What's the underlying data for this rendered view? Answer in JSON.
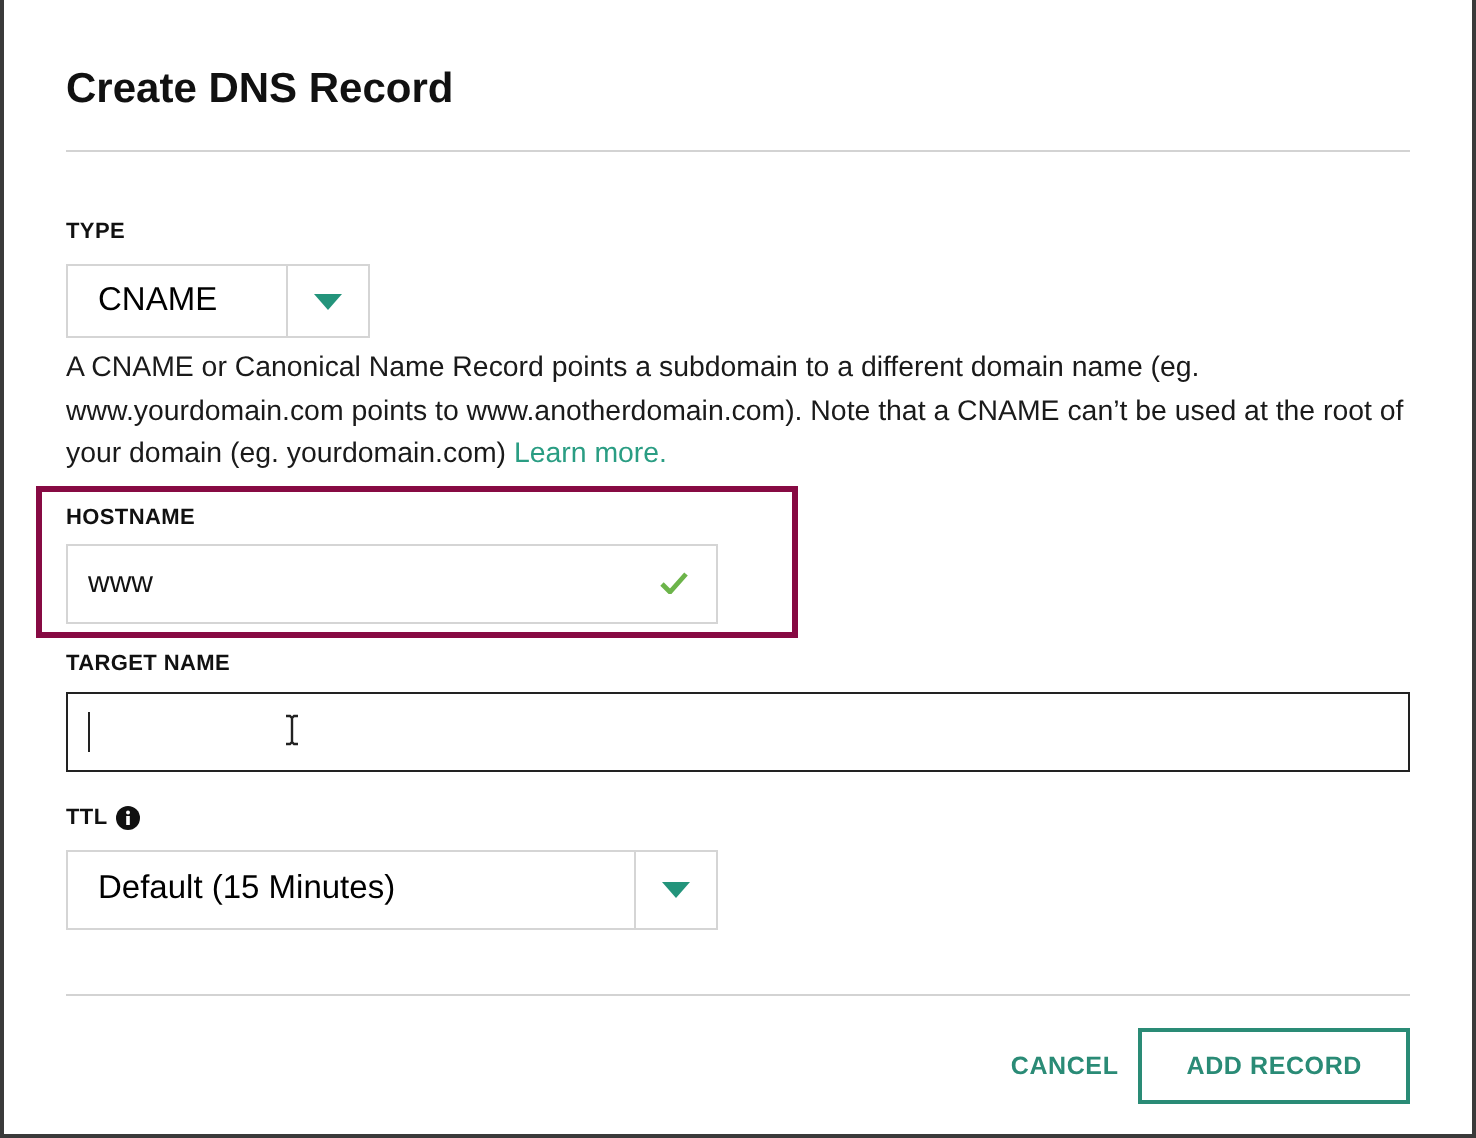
{
  "dialog": {
    "title": "Create DNS Record"
  },
  "type_field": {
    "label": "TYPE",
    "value": "CNAME"
  },
  "description": {
    "text": "A CNAME or Canonical Name Record points a subdomain to a different domain name (eg. www.yourdomain.com points to www.anotherdomain.com). Note that a CNAME can’t be used at the root of your domain (eg. yourdomain.com)",
    "link": "Learn more."
  },
  "hostname_field": {
    "label": "HOSTNAME",
    "value": "www",
    "valid": true,
    "highlighted": true
  },
  "target_field": {
    "label": "TARGET NAME",
    "focused": true
  },
  "ttl_field": {
    "label": "TTL",
    "value": "Default (15 Minutes)"
  },
  "buttons": [
    {
      "label": "CANCEL",
      "kind": "text"
    },
    {
      "label": "ADD RECORD",
      "kind": "outlined"
    }
  ]
}
